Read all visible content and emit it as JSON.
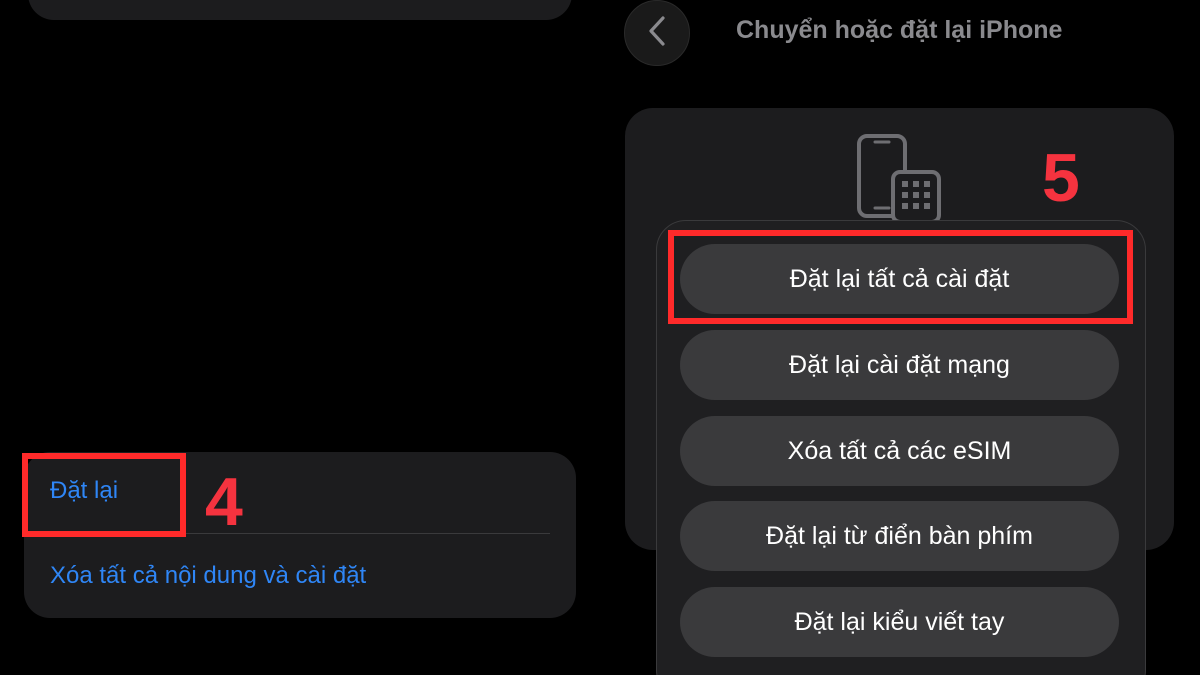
{
  "left_panel": {
    "reset_label": "Đặt lại",
    "erase_label": "Xóa tất cả nội dung và cài đặt",
    "step_number": "4"
  },
  "right_panel": {
    "nav": {
      "back_icon": "chevron-left-icon",
      "title": "Chuyển hoặc đặt lại iPhone"
    },
    "card_icon": "phone-and-keypad-icon",
    "step_number": "5",
    "reset_options": [
      {
        "label": "Đặt lại tất cả cài đặt"
      },
      {
        "label": "Đặt lại cài đặt mạng"
      },
      {
        "label": "Xóa tất cả các eSIM"
      },
      {
        "label": "Đặt lại từ điển bàn phím"
      },
      {
        "label": "Đặt lại kiểu viết tay"
      }
    ]
  },
  "colors": {
    "background": "#000000",
    "card": "#1c1c1e",
    "link_blue": "#2f86f6",
    "highlight_red": "#ff2a2a",
    "step_number_red": "#f5333f",
    "sheet_button": "#3a3a3c"
  }
}
